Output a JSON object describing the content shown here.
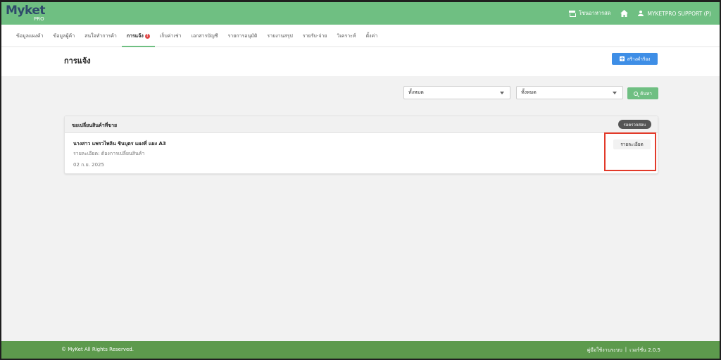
{
  "brand": {
    "logo_text": "Myket",
    "logo_sub": "PRO"
  },
  "topbar": {
    "store_label": "โซนอาหารสด",
    "user_label": "MYKETPRO SUPPORT (P)"
  },
  "menu": {
    "items": [
      {
        "label": "ข้อมูลแผงค้า"
      },
      {
        "label": "ข้อมูลผู้ค้า"
      },
      {
        "label": "สนใจทำการค้า"
      },
      {
        "label": "การแจ้ง",
        "badge": "!"
      },
      {
        "label": "เก็บค่าเช่า"
      },
      {
        "label": "เอกสารบัญชี"
      },
      {
        "label": "รายการอนุมัติ"
      },
      {
        "label": "รายงานสรุป"
      },
      {
        "label": "รายรับ-จ่าย"
      },
      {
        "label": "วิเคราะห์"
      },
      {
        "label": "ตั้งค่า"
      }
    ],
    "active_index": 3
  },
  "page": {
    "title": "การแจ้ง",
    "create_button": "สร้างคำร้อง"
  },
  "filters": {
    "select1_value": "ทั้งหมด",
    "select2_value": "ทั้งหมด",
    "search_button": "ค้นหา"
  },
  "request_card": {
    "title": "ขอเปลี่ยนสินค้าที่ขาย",
    "status": "รอตรวจสอบ",
    "name_line": "นางสาว แพรวไพลิน ชินบุตร แผงที่ แผง A3",
    "detail_line": "รายละเอียด: ต้องการเปลี่ยนสินค้า",
    "date": "02 ก.ย. 2025",
    "detail_button": "รายละเอียด"
  },
  "footer": {
    "copyright": "© MyKet All Rights Reserved.",
    "manual_link": "คู่มือใช้งานระบบ",
    "separator": "|",
    "version": "เวอร์ชั่น 2.0.5"
  },
  "colors": {
    "header_green": "#6fbf82",
    "footer_green": "#5d9a4d",
    "primary_blue": "#3e8ee6",
    "highlight_red": "#e23a2a",
    "status_gray": "#555555"
  },
  "icons": [
    "store-icon",
    "home-icon",
    "user-icon",
    "plus-icon",
    "search-icon",
    "chevron-down-icon"
  ]
}
